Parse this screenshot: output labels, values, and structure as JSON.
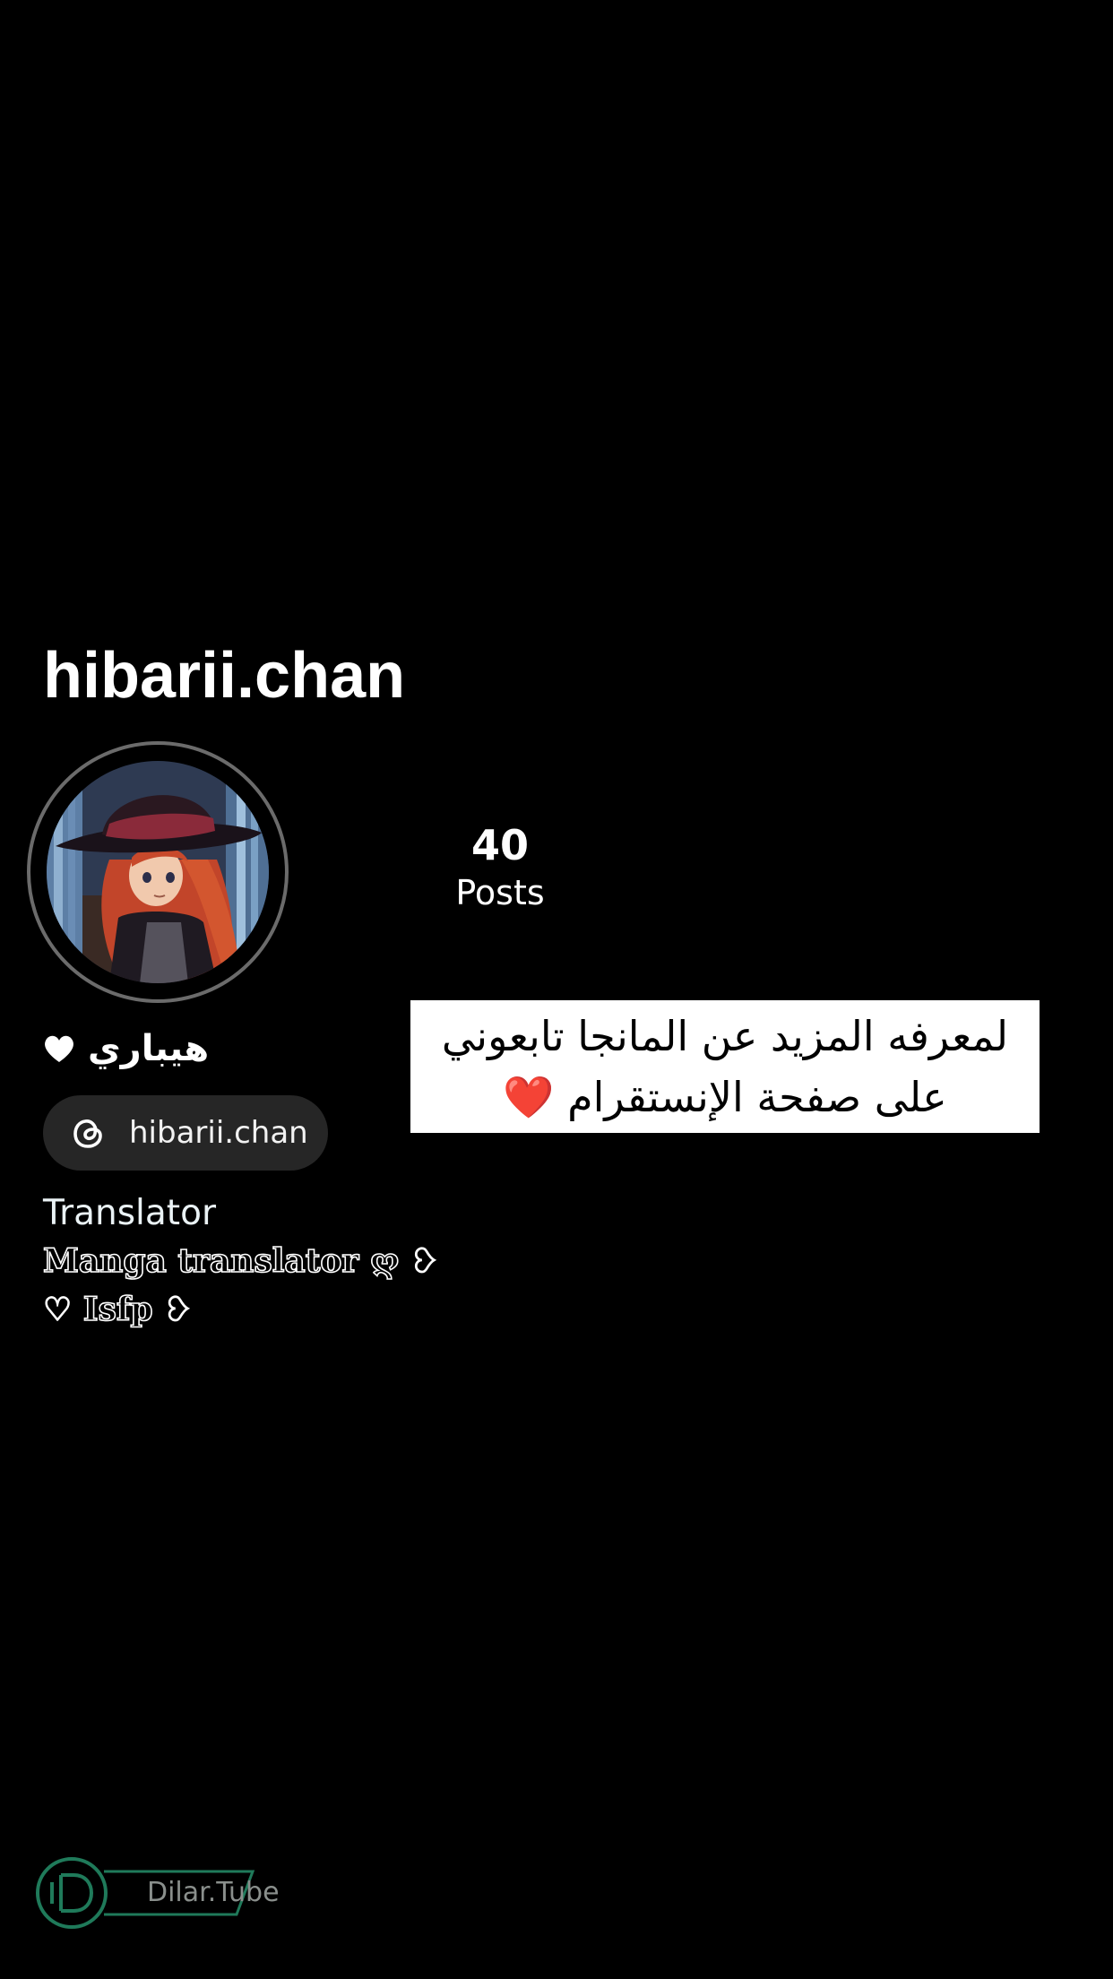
{
  "profile": {
    "username": "hibarii.chan",
    "display_name": "هيباري",
    "stats": {
      "posts_count": "40",
      "posts_label": "Posts"
    },
    "threads_handle": "hibarii.chan",
    "category": "Translator",
    "bio_lines": [
      "Manga translator ღ ❥",
      "♡ Isfp ❥"
    ]
  },
  "overlay": {
    "caption_lines": [
      "لمعرفه المزيد عن المانجا تابعوني",
      "على صفحة الإنستقرام ❤️"
    ]
  },
  "watermark": {
    "text": "Dilar.Tube",
    "color": "#1f7a5a"
  },
  "icons": {
    "display_name_icon": "heart-icon",
    "pill_icon": "threads-icon",
    "watermark_icon": "dilar-tube-logo-icon"
  },
  "colors": {
    "background": "#000000",
    "pill": "#262626",
    "caption_background": "#ffffff",
    "avatar_ring": "#6b6b6b"
  }
}
